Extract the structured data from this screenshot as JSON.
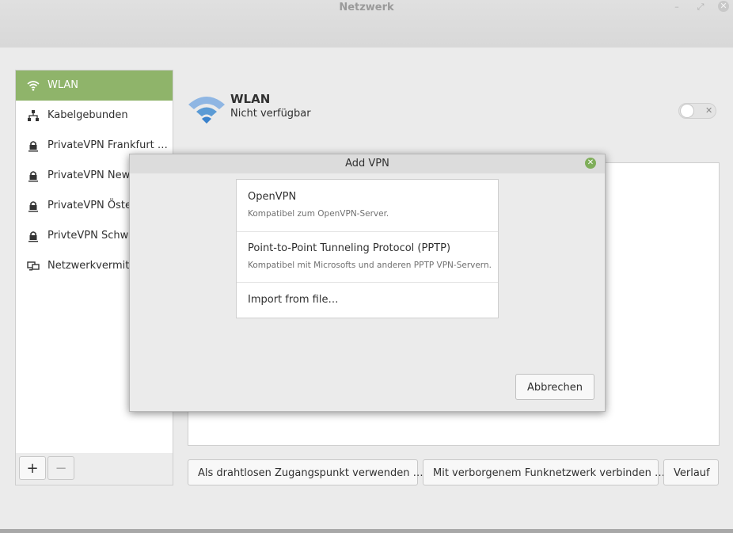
{
  "window": {
    "title": "Netzwerk",
    "minimize_glyph": "–",
    "maximize_glyph": "⤢",
    "close_glyph": "✕"
  },
  "sidebar": {
    "items": [
      {
        "label": "WLAN",
        "icon": "wifi-icon",
        "active": true
      },
      {
        "label": "Kabelgebunden",
        "icon": "wired-network-icon",
        "active": false
      },
      {
        "label": "PrivateVPN Frankfurt …",
        "icon": "vpn-lock-icon",
        "active": false
      },
      {
        "label": "PrivateVPN New",
        "icon": "vpn-lock-icon",
        "active": false
      },
      {
        "label": "PrivateVPN Öster",
        "icon": "vpn-lock-icon",
        "active": false
      },
      {
        "label": "PrivteVPN Schwe",
        "icon": "vpn-lock-icon",
        "active": false
      },
      {
        "label": "Netzwerkvermittl",
        "icon": "network-proxy-icon",
        "active": false
      }
    ],
    "add_label": "+",
    "remove_label": "−"
  },
  "main": {
    "title": "WLAN",
    "status": "Nicht verfügbar",
    "toggle_on": false,
    "toggle_glyph": "✕",
    "buttons": {
      "hotspot": "Als drahtlosen Zugangspunkt verwenden …",
      "hidden": "Mit verborgenem Funknetzwerk verbinden …",
      "history": "Verlauf"
    }
  },
  "dialog": {
    "title": "Add VPN",
    "close_glyph": "✕",
    "options": [
      {
        "name": "OpenVPN",
        "desc": "Kompatibel zum OpenVPN-Server."
      },
      {
        "name": "Point-to-Point Tunneling Protocol (PPTP)",
        "desc": "Kompatibel mit Microsofts und anderen PPTP VPN-Servern."
      },
      {
        "name": "Import from file…",
        "desc": ""
      }
    ],
    "cancel_label": "Abbrechen"
  },
  "colors": {
    "accent": "#8fb46a",
    "wifi_blue": "#5b9bd5"
  }
}
